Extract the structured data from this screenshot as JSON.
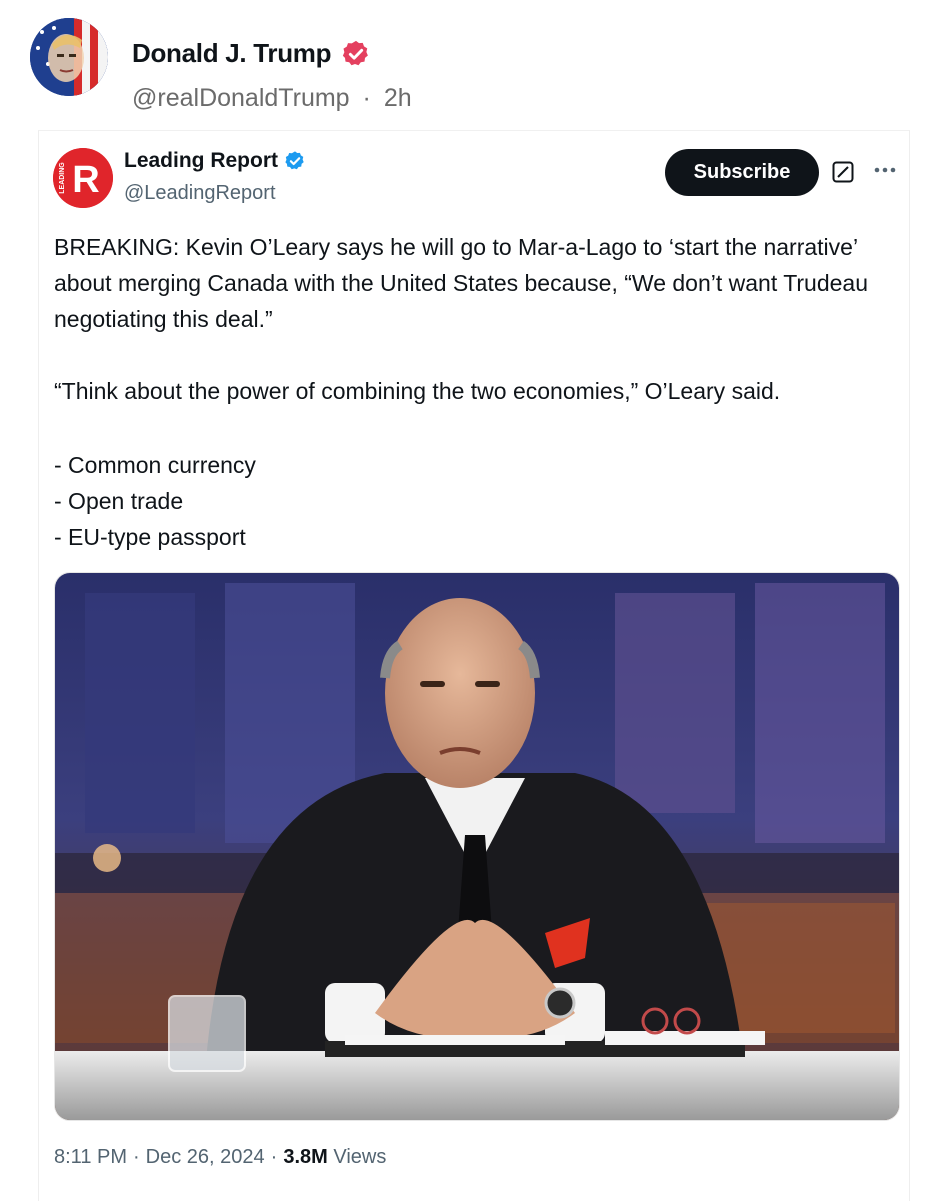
{
  "post": {
    "author_name": "Donald J. Trump",
    "author_handle": "@realDonaldTrump",
    "separator": "·",
    "time_ago": "2h",
    "verified_badge_color": "#e4405f"
  },
  "quoted": {
    "author_name": "Leading Report",
    "author_handle": "@LeadingReport",
    "avatar_letter": "R",
    "avatar_side_text": "LEADING",
    "avatar_color": "#e0252b",
    "verified_badge_color": "#1d9bf0",
    "subscribe_label": "Subscribe",
    "body": {
      "paragraph_1": "BREAKING: Kevin O’Leary says he will go to Mar-a-Lago to ‘start the narrative’ about merging Canada with the United States because, “We don’t want Trudeau negotiating this deal.”",
      "paragraph_2": "“Think about the power of combining the two economies,” O’Leary said.",
      "list": [
        "- Common currency",
        "- Open trade",
        "- EU-type passport"
      ]
    },
    "meta": {
      "time": "8:11 PM",
      "separator": "·",
      "date": "Dec 26, 2024",
      "views_count": "3.8M",
      "views_label": "Views"
    }
  }
}
